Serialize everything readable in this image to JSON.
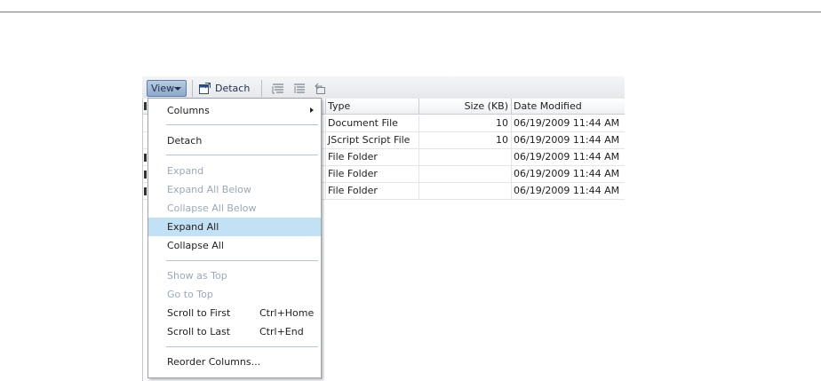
{
  "toolbar": {
    "view_label": "View",
    "detach_label": "Detach"
  },
  "table": {
    "columns": [
      "Type",
      "Size (KB)",
      "Date Modified"
    ],
    "rows": [
      {
        "type": "Document File",
        "size": "10",
        "date": "06/19/2009 11:44 AM"
      },
      {
        "type": "JScript Script File",
        "size": "10",
        "date": "06/19/2009 11:44 AM"
      },
      {
        "type": "File Folder",
        "size": "",
        "date": "06/19/2009 11:44 AM"
      },
      {
        "type": "File Folder",
        "size": "",
        "date": "06/19/2009 11:44 AM"
      },
      {
        "type": "File Folder",
        "size": "",
        "date": "06/19/2009 11:44 AM"
      }
    ]
  },
  "menu": {
    "columns": "Columns",
    "detach": "Detach",
    "expand": "Expand",
    "expand_all_below": "Expand All Below",
    "collapse_all_below": "Collapse All Below",
    "expand_all": "Expand All",
    "collapse_all": "Collapse All",
    "show_as_top": "Show as Top",
    "go_to_top": "Go to Top",
    "scroll_to_first": "Scroll to First",
    "scroll_to_first_shortcut": "Ctrl+Home",
    "scroll_to_last": "Scroll to Last",
    "scroll_to_last_shortcut": "Ctrl+End",
    "reorder_columns": "Reorder Columns..."
  },
  "colors": {
    "menu_highlight": "#c3e1f5",
    "disabled_text": "#9aa8b8",
    "view_button": "#8da9ca"
  }
}
